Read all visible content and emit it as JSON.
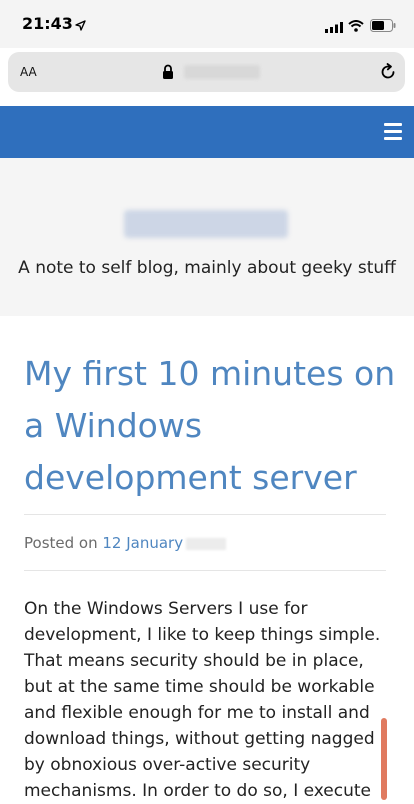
{
  "status_bar": {
    "time": "21:43"
  },
  "browser": {
    "text_size_label": "AA"
  },
  "header": {
    "tagline": "A note to self blog, mainly about geeky stuff"
  },
  "post": {
    "title": "My first 10 minutes on a Windows development server",
    "posted_on_label": "Posted on",
    "date": "12 January",
    "body": "On the Windows Servers I use for development, I like to keep things simple. That means security should be in place, but at the same time should be workable and flexible enough for me to install and download things, without getting nagged by obnoxious over-active security mechanisms. In order to do so, I execute"
  },
  "colors": {
    "nav_background": "#2f6fbd",
    "link": "#4f86c0",
    "scroll_indicator": "#e07a5f"
  },
  "icons": [
    "location-arrow-icon",
    "signal-icon",
    "wifi-icon",
    "battery-icon",
    "lock-icon",
    "reload-icon",
    "hamburger-menu-icon"
  ]
}
